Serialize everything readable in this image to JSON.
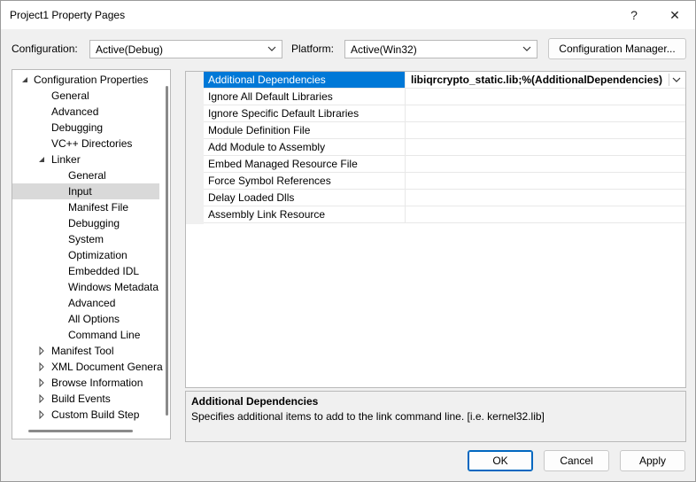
{
  "window": {
    "title": "Project1 Property Pages",
    "help_label": "?",
    "close_label": "✕"
  },
  "config_bar": {
    "configuration_label": "Configuration:",
    "configuration_value": "Active(Debug)",
    "platform_label": "Platform:",
    "platform_value": "Active(Win32)",
    "manager_button": "Configuration Manager..."
  },
  "tree": {
    "items": [
      {
        "label": "Configuration Properties",
        "level": 0,
        "expander": "expanded"
      },
      {
        "label": "General",
        "level": 1,
        "expander": "none"
      },
      {
        "label": "Advanced",
        "level": 1,
        "expander": "none"
      },
      {
        "label": "Debugging",
        "level": 1,
        "expander": "none"
      },
      {
        "label": "VC++ Directories",
        "level": 1,
        "expander": "none"
      },
      {
        "label": "Linker",
        "level": 1,
        "expander": "expanded"
      },
      {
        "label": "General",
        "level": 2,
        "expander": "none"
      },
      {
        "label": "Input",
        "level": 2,
        "expander": "none",
        "selected": true
      },
      {
        "label": "Manifest File",
        "level": 2,
        "expander": "none"
      },
      {
        "label": "Debugging",
        "level": 2,
        "expander": "none"
      },
      {
        "label": "System",
        "level": 2,
        "expander": "none"
      },
      {
        "label": "Optimization",
        "level": 2,
        "expander": "none"
      },
      {
        "label": "Embedded IDL",
        "level": 2,
        "expander": "none"
      },
      {
        "label": "Windows Metadata",
        "level": 2,
        "expander": "none"
      },
      {
        "label": "Advanced",
        "level": 2,
        "expander": "none"
      },
      {
        "label": "All Options",
        "level": 2,
        "expander": "none"
      },
      {
        "label": "Command Line",
        "level": 2,
        "expander": "none"
      },
      {
        "label": "Manifest Tool",
        "level": 1,
        "expander": "collapsed"
      },
      {
        "label": "XML Document Genera",
        "level": 1,
        "expander": "collapsed"
      },
      {
        "label": "Browse Information",
        "level": 1,
        "expander": "collapsed"
      },
      {
        "label": "Build Events",
        "level": 1,
        "expander": "collapsed"
      },
      {
        "label": "Custom Build Step",
        "level": 1,
        "expander": "collapsed"
      }
    ]
  },
  "properties": [
    {
      "name": "Additional Dependencies",
      "value": "libiqrcrypto_static.lib;%(AdditionalDependencies)",
      "selected": true
    },
    {
      "name": "Ignore All Default Libraries",
      "value": ""
    },
    {
      "name": "Ignore Specific Default Libraries",
      "value": ""
    },
    {
      "name": "Module Definition File",
      "value": ""
    },
    {
      "name": "Add Module to Assembly",
      "value": ""
    },
    {
      "name": "Embed Managed Resource File",
      "value": ""
    },
    {
      "name": "Force Symbol References",
      "value": ""
    },
    {
      "name": "Delay Loaded Dlls",
      "value": ""
    },
    {
      "name": "Assembly Link Resource",
      "value": ""
    }
  ],
  "description": {
    "title": "Additional Dependencies",
    "text": "Specifies additional items to add to the link command line. [i.e. kernel32.lib]"
  },
  "buttons": {
    "ok": "OK",
    "cancel": "Cancel",
    "apply": "Apply"
  },
  "colors": {
    "selection": "#0078d7",
    "primary_button_border": "#0067c0",
    "tree_selection": "#d9d9d9"
  }
}
